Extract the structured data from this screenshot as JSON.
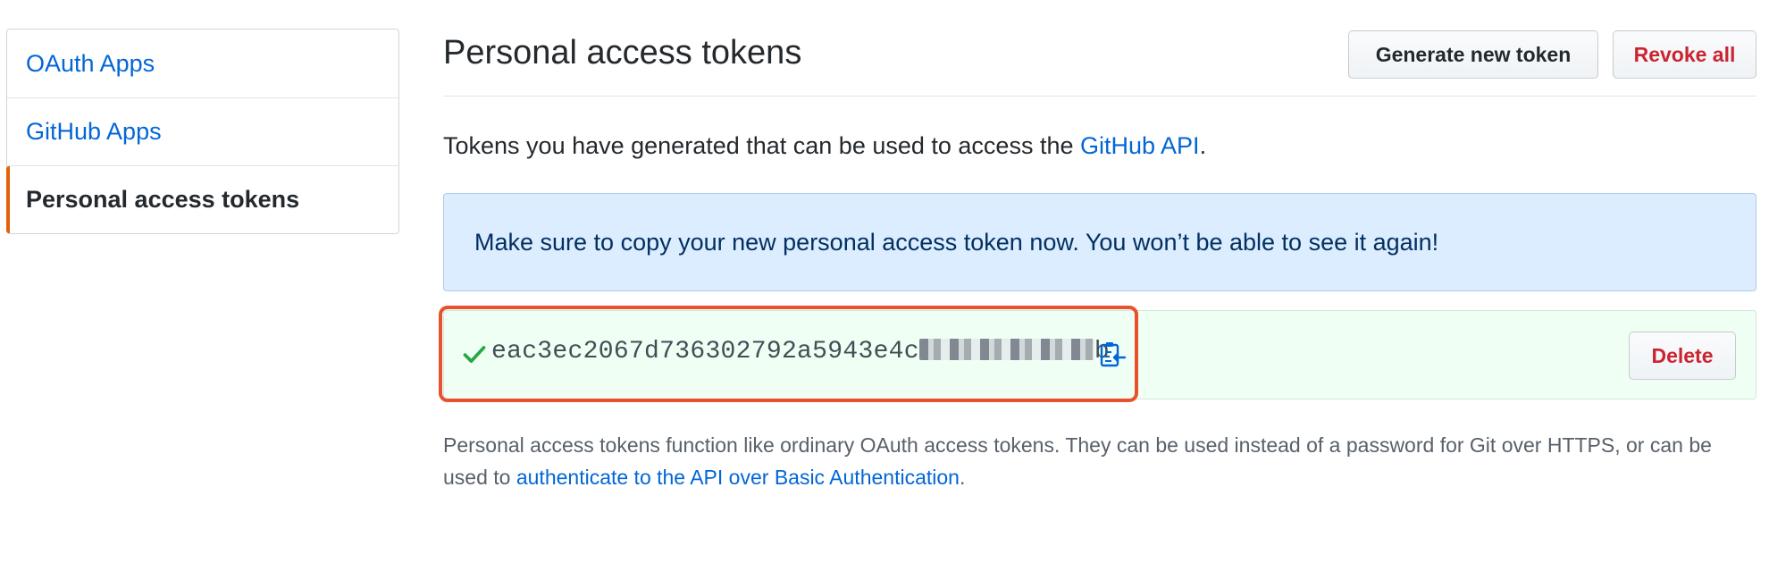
{
  "sidebar": {
    "items": [
      {
        "label": "OAuth Apps",
        "selected": false
      },
      {
        "label": "GitHub Apps",
        "selected": false
      },
      {
        "label": "Personal access tokens",
        "selected": true
      }
    ]
  },
  "header": {
    "title": "Personal access tokens",
    "generate_label": "Generate new token",
    "revoke_label": "Revoke all"
  },
  "intro": {
    "text_before": "Tokens you have generated that can be used to access the ",
    "link_text": "GitHub API",
    "text_after": "."
  },
  "notice": {
    "text": "Make sure to copy your new personal access token now. You won’t be able to see it again!"
  },
  "token": {
    "visible_prefix": "eac3ec2067d736302792a5943e4c",
    "visible_suffix": "b",
    "delete_label": "Delete",
    "icons": [
      "check-icon",
      "clipboard-icon"
    ]
  },
  "footer": {
    "text_before": "Personal access tokens function like ordinary OAuth access tokens. They can be used instead of a password for Git over HTTPS, or can be used to ",
    "link_text": "authenticate to the API over Basic Authentication",
    "text_after": "."
  },
  "colors": {
    "link": "#0366d6",
    "danger": "#cb2431",
    "selected_accent": "#e36209",
    "notice_bg": "#dbedff",
    "token_bg": "#f0fff4",
    "highlight_border": "#e8512e",
    "check_green": "#28a745"
  }
}
